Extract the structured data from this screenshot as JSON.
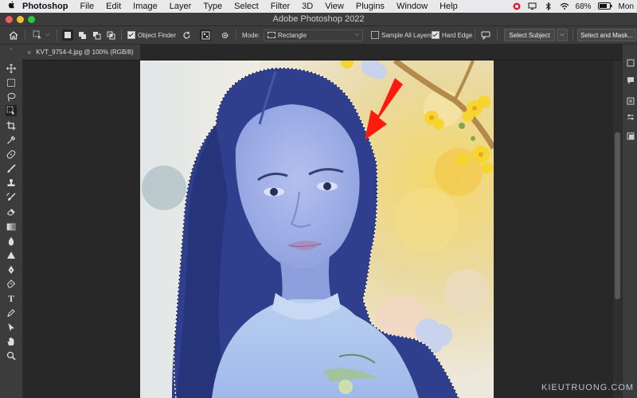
{
  "menubar": {
    "apple_icon": "apple-logo",
    "items": [
      "Photoshop",
      "File",
      "Edit",
      "Image",
      "Layer",
      "Type",
      "Select",
      "Filter",
      "3D",
      "View",
      "Plugins",
      "Window",
      "Help"
    ],
    "battery_text": "68%",
    "clock_text": "Mon"
  },
  "window": {
    "title": "Adobe Photoshop 2022"
  },
  "options_bar": {
    "object_finder_label": "Object Finder",
    "object_finder_checked": true,
    "mode_label": "Mode:",
    "mode_value": "Rectangle",
    "sample_all_layers_label": "Sample All Layers",
    "sample_all_layers_checked": false,
    "hard_edge_label": "Hard Edge",
    "hard_edge_checked": true,
    "select_subject_label": "Select Subject",
    "select_and_mask_label": "Select and Mask..."
  },
  "document": {
    "tab_title": "KVT_9754-4.jpg @ 100% (RGB/8)",
    "close_glyph": "×"
  },
  "tools": [
    "move-tool",
    "marquee-tool",
    "lasso-tool",
    "object-selection-tool",
    "crop-tool",
    "eyedropper-tool",
    "healing-brush-tool",
    "brush-tool",
    "clone-stamp-tool",
    "history-brush-tool",
    "eraser-tool",
    "gradient-tool",
    "blur-tool",
    "dodge-tool",
    "pen-tool",
    "type-tool",
    "path-selection-tool",
    "shape-tool",
    "hand-tool",
    "zoom-tool"
  ],
  "watermark": "KIEUTRUONG.COM",
  "colors": {
    "selection_overlay": "#5a7fd6",
    "annotation_arrow": "#ff1a0f",
    "app_dark": "#3c3c3c"
  }
}
